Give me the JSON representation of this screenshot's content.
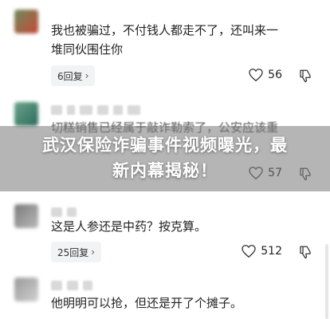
{
  "comments": [
    {
      "text_line1": "我也被骗过，不付钱人都走不了，还叫来一",
      "text_line2": "堆同伙围住你",
      "replies": "6回复",
      "likes": "56"
    },
    {
      "text_line1": "切糕销售已经属于敲诈勒索了，公安应该重",
      "replies": "",
      "likes": "57"
    },
    {
      "text_line1": "这是人参还是中药？按克算。",
      "replies": "25回复",
      "likes": "512"
    },
    {
      "text_line1": "他明明可以抢，但还是开了个摊子。"
    }
  ],
  "headline": {
    "line1": "武汉保险诈骗事件视频曝光，最",
    "line2": "新内幕揭秘！"
  },
  "icons": {
    "heart": "heart-icon",
    "dislike": "thumbs-down-icon",
    "chevron": "chevron-right-icon"
  },
  "colors": {
    "overlay": "#787878",
    "reply_pill": "#f2f3f5"
  }
}
